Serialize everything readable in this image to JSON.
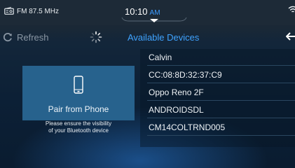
{
  "status_bar": {
    "radio_station": "FM 87.5 MHz",
    "time": "10:10",
    "ampm": "AM",
    "radio_icon": "radio-icon",
    "wifi_icon": "wifi-icon"
  },
  "toolbar": {
    "refresh_label": "Refresh",
    "refresh_icon": "refresh-icon",
    "spinner_icon": "spinner-icon",
    "title": "Available Devices",
    "back_icon": "back-arrow-icon"
  },
  "pair_panel": {
    "icon": "phone-icon",
    "label": "Pair from Phone",
    "hint_line1": "Please ensure the visibility",
    "hint_line2": "of your Bluetooth device"
  },
  "devices": [
    {
      "name": "Calvin"
    },
    {
      "name": "CC:08:8D:32:37:C9"
    },
    {
      "name": "Oppo Reno 2F"
    },
    {
      "name": "ANDROIDSDL"
    },
    {
      "name": "CM14COLTRND005"
    }
  ],
  "colors": {
    "accent": "#3fa3ff",
    "ampm": "#3b9bff",
    "pair_panel_bg": "#27628d",
    "status_bar_bg": "#1d2a37"
  }
}
